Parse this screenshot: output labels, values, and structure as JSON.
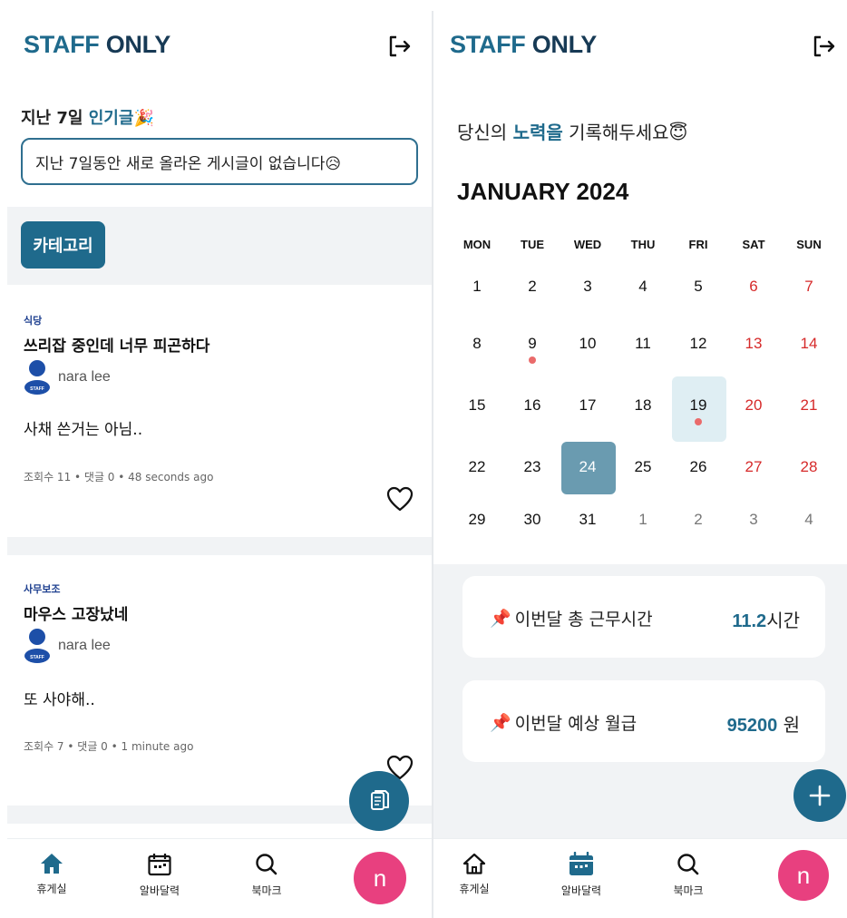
{
  "colors": {
    "primary": "#1f6a8c",
    "navy": "#173a55",
    "weekend": "#d62a2a",
    "avatar": "#e8407f",
    "background_gray": "#f1f3f5"
  },
  "left": {
    "brand": {
      "part1": "STAFF",
      "part2": "ONLY"
    },
    "popular": {
      "prefix": "지난 7일 ",
      "highlight": "인기글",
      "emoji": "🎉",
      "empty_message": "지난 7일동안 새로 올라온 게시글이 없습니다😥"
    },
    "category_button": "카테고리",
    "posts": [
      {
        "category": "식당",
        "title": "쓰리잡 중인데 너무 피곤하다",
        "author": "nara lee",
        "body": "사채 쓴거는 아님..",
        "meta": "조회수 11 • 댓글 0 • 48 seconds ago",
        "avatar_badge": "STAFF"
      },
      {
        "category": "사무보조",
        "title": "마우스 고장났네",
        "author": "nara lee",
        "body": "또 사야해..",
        "meta": "조회수 7 • 댓글 0 • 1 minute ago",
        "avatar_badge": "STAFF"
      }
    ],
    "nav": [
      {
        "label": "휴게실",
        "icon": "home-icon"
      },
      {
        "label": "알바달력",
        "icon": "calendar-icon"
      },
      {
        "label": "북마크",
        "icon": "search-icon"
      }
    ],
    "avatar_letter": "n"
  },
  "right": {
    "brand": {
      "part1": "STAFF",
      "part2": "ONLY"
    },
    "motto": {
      "prefix": "당신의 ",
      "highlight": "노력을",
      "suffix": " 기록해두세요😇"
    },
    "calendar": {
      "month_label": "JANUARY 2024",
      "weekdays": [
        "MON",
        "TUE",
        "WED",
        "THU",
        "FRI",
        "SAT",
        "SUN"
      ],
      "weeks": [
        [
          "1",
          "2",
          "3",
          "4",
          "5",
          "6",
          "7"
        ],
        [
          "8",
          "9",
          "10",
          "11",
          "12",
          "13",
          "14"
        ],
        [
          "15",
          "16",
          "17",
          "18",
          "19",
          "20",
          "21"
        ],
        [
          "22",
          "23",
          "24",
          "25",
          "26",
          "27",
          "28"
        ],
        [
          "29",
          "30",
          "31",
          "1",
          "2",
          "3",
          "4"
        ]
      ],
      "today": "24",
      "selected": "19",
      "marked_days": [
        "9",
        "19"
      ]
    },
    "stats": [
      {
        "pin": "📌",
        "label": "이번달 총 근무시간",
        "value": "11.2",
        "unit": "시간"
      },
      {
        "pin": "📌",
        "label": "이번달 예상 월급",
        "value": "95200",
        "unit": " 원"
      }
    ],
    "nav": [
      {
        "label": "휴게실",
        "icon": "home-outline-icon"
      },
      {
        "label": "알바달력",
        "icon": "calendar-icon"
      },
      {
        "label": "북마크",
        "icon": "search-icon"
      }
    ],
    "avatar_letter": "n"
  }
}
